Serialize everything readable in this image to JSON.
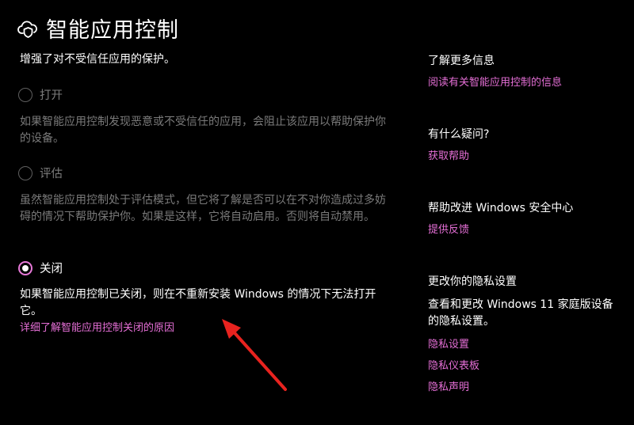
{
  "header": {
    "title": "智能应用控制",
    "icon": "cloud-shield-icon"
  },
  "subtitle": "增强了对不受信任应用的保护。",
  "options": [
    {
      "label": "打开",
      "checked": false,
      "description": "如果智能应用控制发现恶意或不受信任的应用，会阻止该应用以帮助保护你的设备。"
    },
    {
      "label": "评估",
      "checked": false,
      "description": "虽然智能应用控制处于评估模式，但它将了解是否可以在不对你造成过多妨碍的情况下帮助保护你。如果是这样，它将自动启用。否则将自动禁用。"
    },
    {
      "label": "关闭",
      "checked": true,
      "description": "如果智能应用控制已关闭，则在不重新安装 Windows 的情况下无法打开它。"
    }
  ],
  "off_reason_link": "详细了解智能应用控制关闭的原因",
  "sidebar": {
    "learn_more": {
      "heading": "了解更多信息",
      "link": "阅读有关智能应用控制的信息"
    },
    "questions": {
      "heading": "有什么疑问?",
      "link": "获取帮助"
    },
    "improve": {
      "heading": "帮助改进 Windows 安全中心",
      "link": "提供反馈"
    },
    "privacy": {
      "heading": "更改你的隐私设置",
      "text": "查看和更改 Windows 11 家庭版设备的隐私设置。",
      "links": [
        "隐私设置",
        "隐私仪表板",
        "隐私声明"
      ]
    }
  },
  "colors": {
    "background": "#000000",
    "accent": "#e56fd6",
    "annotation_arrow": "#e8231f"
  }
}
